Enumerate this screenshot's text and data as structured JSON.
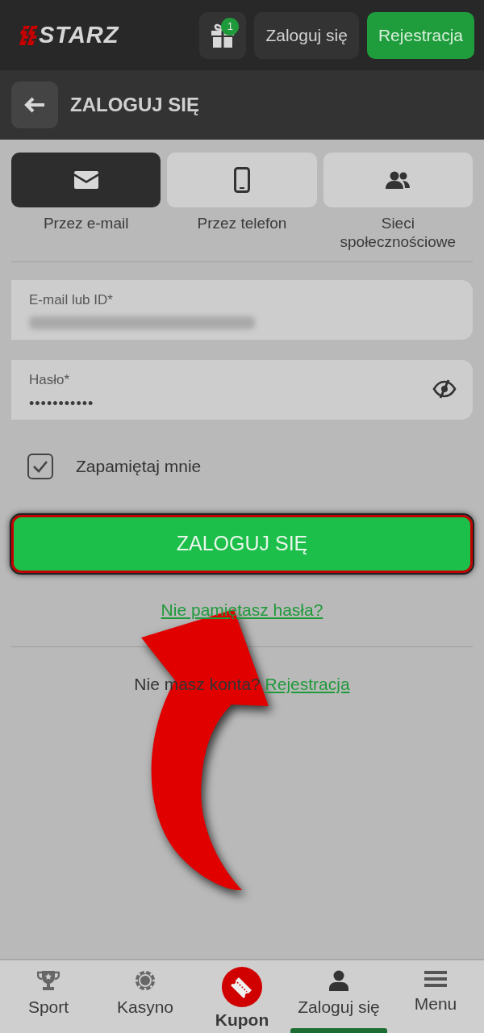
{
  "header": {
    "logo_text": "STARZ",
    "gift_badge": "1",
    "login_button": "Zaloguj się",
    "register_button": "Rejestracja"
  },
  "page_title": "ZALOGUJ SIĘ",
  "methods": [
    {
      "kind": "email",
      "label": "Przez e-mail",
      "selected": true
    },
    {
      "kind": "phone",
      "label": "Przez telefon",
      "selected": false
    },
    {
      "kind": "social",
      "label": "Sieci społecznościowe",
      "selected": false
    }
  ],
  "fields": [
    {
      "kind": "email",
      "label": "E-mail lub ID*"
    },
    {
      "kind": "password",
      "label": "Hasło*",
      "value": "•••••••••••"
    }
  ],
  "remember": {
    "label": "Zapamiętaj mnie",
    "checked": true
  },
  "submit": "ZALOGUJ SIĘ",
  "forgot": "Nie pamiętasz hasła?",
  "signup": {
    "text": "Nie masz konta?",
    "link": "Rejestracja"
  },
  "bottom_nav": [
    {
      "kind": "sport",
      "label": "Sport",
      "selected": false
    },
    {
      "kind": "casino",
      "label": "Kasyno",
      "selected": false
    },
    {
      "kind": "coupon",
      "label": "Kupon",
      "selected": false
    },
    {
      "kind": "user",
      "label": "Zaloguj się",
      "selected": true
    },
    {
      "kind": "menu",
      "label": "Menu",
      "selected": false
    }
  ]
}
